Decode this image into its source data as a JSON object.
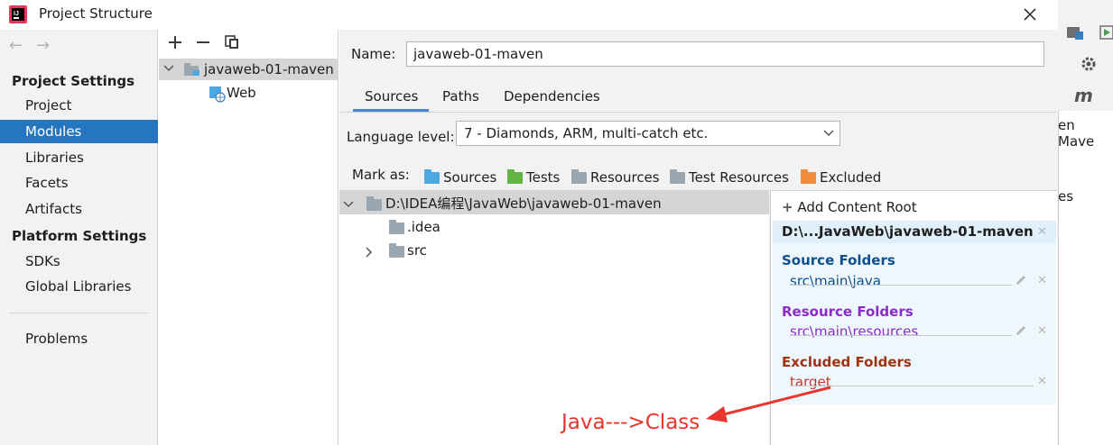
{
  "window": {
    "title": "Project Structure"
  },
  "sidebar": {
    "project_settings_header": "Project Settings",
    "project_items": [
      "Project",
      "Modules",
      "Libraries",
      "Facets",
      "Artifacts"
    ],
    "selected": "Modules",
    "platform_settings_header": "Platform Settings",
    "platform_items": [
      "SDKs",
      "Global Libraries"
    ],
    "problems": "Problems"
  },
  "modules": {
    "module_name": "javaweb-01-maven",
    "facet": "Web"
  },
  "detail": {
    "name_label": "Name:",
    "name_value": "javaweb-01-maven",
    "tabs": [
      "Sources",
      "Paths",
      "Dependencies"
    ],
    "active_tab": "Sources",
    "language_level_label": "Language level:",
    "language_level_value": "7 - Diamonds, ARM, multi-catch etc.",
    "mark_as_label": "Mark as:",
    "mark_as": [
      {
        "label": "Sources",
        "color": "#4aa9e0"
      },
      {
        "label": "Tests",
        "color": "#62b543"
      },
      {
        "label": "Resources",
        "color": "#9aa7b0"
      },
      {
        "label": "Test Resources",
        "color": "#9aa7b0"
      },
      {
        "label": "Excluded",
        "color": "#f28c3c"
      }
    ]
  },
  "content_tree": {
    "root": "D:\\IDEA编程\\JavaWeb\\javaweb-01-maven",
    "children": [
      ".idea",
      "src"
    ]
  },
  "content_roots": {
    "add_label": "Add Content Root",
    "root_path": "D:\\...JavaWeb\\javaweb-01-maven",
    "source_title": "Source Folders",
    "source_item": "src\\main\\java",
    "resource_title": "Resource Folders",
    "resource_item": "src\\main\\resources",
    "excluded_title": "Excluded Folders",
    "excluded_item": "target",
    "colors": {
      "source": "#0e4f8f",
      "resource": "#8c2bc6",
      "excluded": "#9e3312"
    }
  },
  "behind_window": {
    "text1": "en Mave",
    "text2": "es"
  },
  "annotation": "Java--->Class"
}
